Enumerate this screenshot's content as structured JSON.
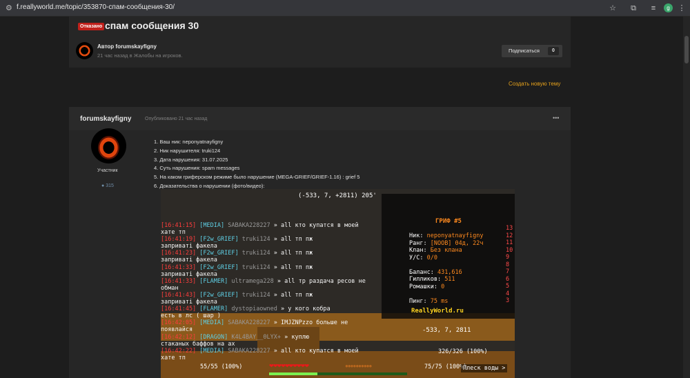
{
  "browser": {
    "url": "f.reallyworld.me/topic/353870-спам-сообщения-30/",
    "avatar_letter": "g"
  },
  "topic": {
    "status_badge": "Отказано",
    "title": "спам сообщения 30",
    "author_line": "Автор forumskayfigny",
    "meta": "21 час назад в Жалобы на игроков.",
    "subscribe_label": "Подписаться",
    "subscribe_count": "0",
    "new_topic": "Создать новую тему"
  },
  "post": {
    "author": "forumskayfigny",
    "date": "Опубликовано 21 час назад",
    "menu": "•••",
    "role": "Участник",
    "post_count": "315",
    "body": [
      "1. Ваш ник: neponyatnayfigny",
      "2. Ник нарушителя: truki124",
      "3. Дата нарушения: 31.07.2025",
      "4. Суть нарушения: spam messages",
      "5. На каком гриферском режиме было нарушение (MEGA-GRIEF/GRIEF-1.16) : grief 5",
      "6. Доказательства о нарушении (фото/видео):"
    ]
  },
  "game": {
    "coords": "(-533, 7, +2811) 205'",
    "chat": [
      {
        "time": "[16:41:15]",
        "tag": "[MEDIA]",
        "name": "SABAKA228227",
        "msg": " » all кто купатся в моей"
      },
      {
        "time": "",
        "tag": "",
        "name": "",
        "msg": "хате тп"
      },
      {
        "time": "[16:41:19]",
        "tag": "[F2w_GRIEF]",
        "name": "truki124",
        "msg": " » all тп пж"
      },
      {
        "time": "",
        "tag": "",
        "name": "",
        "msg": "заприваті факела"
      },
      {
        "time": "[16:41:23]",
        "tag": "[F2w_GRIEF]",
        "name": "truki124",
        "msg": " » all тп пж"
      },
      {
        "time": "",
        "tag": "",
        "name": "",
        "msg": "заприваті факела"
      },
      {
        "time": "[16:41:33]",
        "tag": "[F2w_GRIEF]",
        "name": "truki124",
        "msg": " » all тп пж"
      },
      {
        "time": "",
        "tag": "",
        "name": "",
        "msg": "заприваті факела"
      },
      {
        "time": "[16:41:33]",
        "tag": "[FLAMER]",
        "name": "ultramega228",
        "msg": " » all тр раздача ресов не"
      },
      {
        "time": "",
        "tag": "",
        "name": "",
        "msg": "обман"
      },
      {
        "time": "[16:41:43]",
        "tag": "[F2w_GRIEF]",
        "name": "truki124",
        "msg": " » all тп пж"
      },
      {
        "time": "",
        "tag": "",
        "name": "",
        "msg": "заприваті факела"
      },
      {
        "time": "[16:41:45]",
        "tag": "[FLAMER]",
        "name": "dystopiaowned",
        "msg": " » у кого кобра"
      },
      {
        "time": "",
        "tag": "",
        "name": "",
        "msg": "есть в лс ( шар )"
      },
      {
        "time": "[16:42:05]",
        "tag": "[MEDIA]",
        "name": "SABAKA228227",
        "msg": " » IMJZNPzzo больше не"
      },
      {
        "time": "",
        "tag": "",
        "name": "",
        "msg": "появлайся"
      },
      {
        "time": "[16:42:12]",
        "tag": "[DRAGON]",
        "name": "K4L4BAY__0LYX+",
        "msg": " » куплю"
      },
      {
        "time": "",
        "tag": "",
        "name": "",
        "msg": "стаканых баффов на ах"
      },
      {
        "time": "[16:42:22]",
        "tag": "[MEDIA]",
        "name": "SABAKA228227",
        "msg": " » all кто купатся в моей"
      },
      {
        "time": "",
        "tag": "",
        "name": "",
        "msg": "хате тп"
      }
    ],
    "scoreboard_title": "ГРИФ #5",
    "scoreboard_lines": [
      {
        "label": "Ник: ",
        "value": "neponyatnayfigny"
      },
      {
        "label": "Ранг: ",
        "value": "[NOOB] 04д, 22ч"
      },
      {
        "label": "Клан: ",
        "value": "Без клана"
      },
      {
        "label": "У/С: ",
        "value": "0/0"
      },
      {
        "label": "",
        "value": ""
      },
      {
        "label": "Баланс: ",
        "value": "431,616"
      },
      {
        "label": "Гилликов: ",
        "value": "511"
      },
      {
        "label": "Ромашки: ",
        "value": "0"
      },
      {
        "label": "",
        "value": ""
      },
      {
        "label": "Пинг: ",
        "value": "75 ms"
      }
    ],
    "scoreboard_nums": [
      "13",
      "12",
      "11",
      "10",
      "9",
      "8",
      "7",
      "6",
      "5",
      "4",
      "3"
    ],
    "scoreboard_site": "ReallyWorld.ru",
    "pos2": "-533, 7, 2811",
    "hp_left": "55/55 (100%)",
    "hp_right": "326/326 (100%)",
    "hp_right2": "75/75 (100%)",
    "xp_level": "29",
    "xp_fraction": 0.35,
    "sound_tip": "Плеск воды >"
  }
}
